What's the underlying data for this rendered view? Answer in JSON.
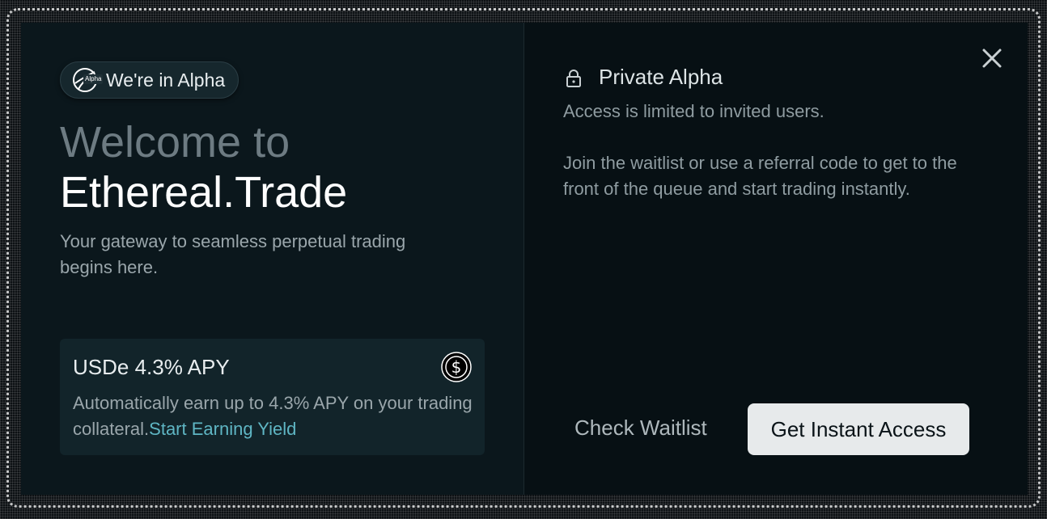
{
  "left": {
    "badge_text": "We're in Alpha",
    "badge_tag": "Alpha",
    "welcome": "Welcome to",
    "brand": "Ethereal.Trade",
    "tagline": "Your gateway to seamless perpetual trading begins here.",
    "promo": {
      "title": "USDe 4.3% APY",
      "text": "Automatically earn up to 4.3% APY on your trading collateral.",
      "link": "Start Earning Yield",
      "icon": "usdc-dollar-icon"
    }
  },
  "right": {
    "title": "Private Alpha",
    "desc1": "Access is limited to invited users.",
    "desc2": "Join the waitlist or use a referral code to get to the front of the queue and start trading instantly.",
    "secondary_button": "Check Waitlist",
    "primary_button": "Get Instant Access"
  },
  "colors": {
    "modal_bg": "#071115",
    "left_bg": "#0b171c",
    "accent_link": "#5fb6c4",
    "primary_button_bg": "#e7eaeb"
  }
}
